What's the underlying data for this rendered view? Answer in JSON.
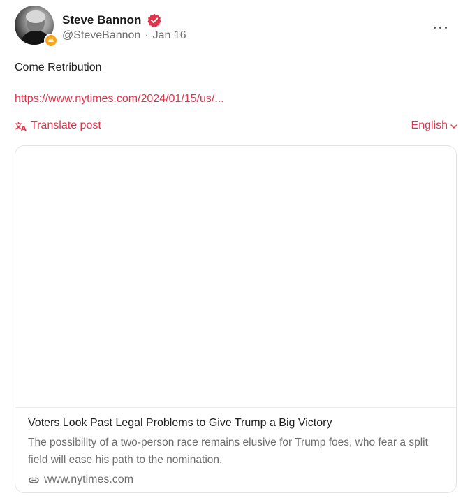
{
  "post": {
    "author": {
      "display_name": "Steve Bannon",
      "handle": "@SteveBannon",
      "separator": "·",
      "date": "Jan 16",
      "verified": true
    },
    "text": "Come Retribution",
    "link_text": "https://www.nytimes.com/2024/01/15/us/...",
    "translate_label": "Translate post",
    "language": "English",
    "more_icon": "more-horizontal-icon"
  },
  "link_card": {
    "title": "Voters Look Past Legal Problems to Give Trump a Big Victory",
    "description": "The possibility of a two-person race remains elusive for Trump foes, who fear a split field will ease his path to the nomination.",
    "domain": "www.nytimes.com",
    "domain_icon": "link-icon"
  },
  "colors": {
    "accent": "#e0334a",
    "text_primary": "#212121",
    "text_secondary": "#6e6e6e",
    "border": "#e3e3e3",
    "badge": "#f5a623"
  }
}
